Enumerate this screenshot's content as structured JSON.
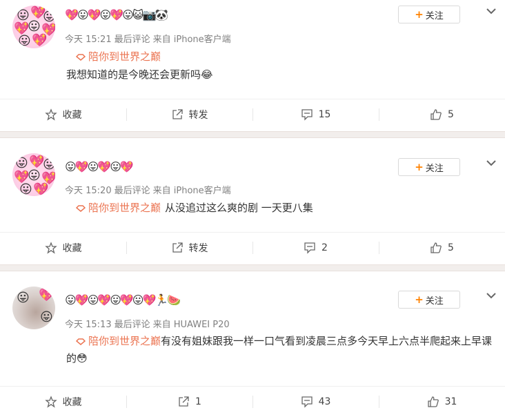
{
  "topic_label": "陪你到世界之巅",
  "follow_label": "关注",
  "posts": [
    {
      "nickname": "💖😛💖😛💖😛😺📷🐼",
      "time": "今天 15:21",
      "meta_label": "最后评论",
      "source": "来自 iPhone客户端",
      "text": "我想知道的是今晚还会更新吗😂",
      "actions": {
        "favorite": "收藏",
        "repost": "转发",
        "comments": "15",
        "likes": "5"
      }
    },
    {
      "nickname": "😛💖😛💖😛💖",
      "time": "今天 15:20",
      "meta_label": "最后评论",
      "source": "来自 iPhone客户端",
      "text": "从没追过这么爽的剧 一天更八集",
      "actions": {
        "favorite": "收藏",
        "repost": "转发",
        "comments": "2",
        "likes": "5"
      }
    },
    {
      "nickname": "😛💖😛💖😛💖😛💖🏃🍉",
      "time": "今天 15:13",
      "meta_label": "最后评论",
      "source": "来自 HUAWEI P20",
      "text": "有没有姐妹跟我一样一口气看到凌晨三点多今天早上六点半爬起来上早课的😳",
      "actions": {
        "favorite": "收藏",
        "repost": "1",
        "comments": "43",
        "likes": "31"
      }
    }
  ]
}
